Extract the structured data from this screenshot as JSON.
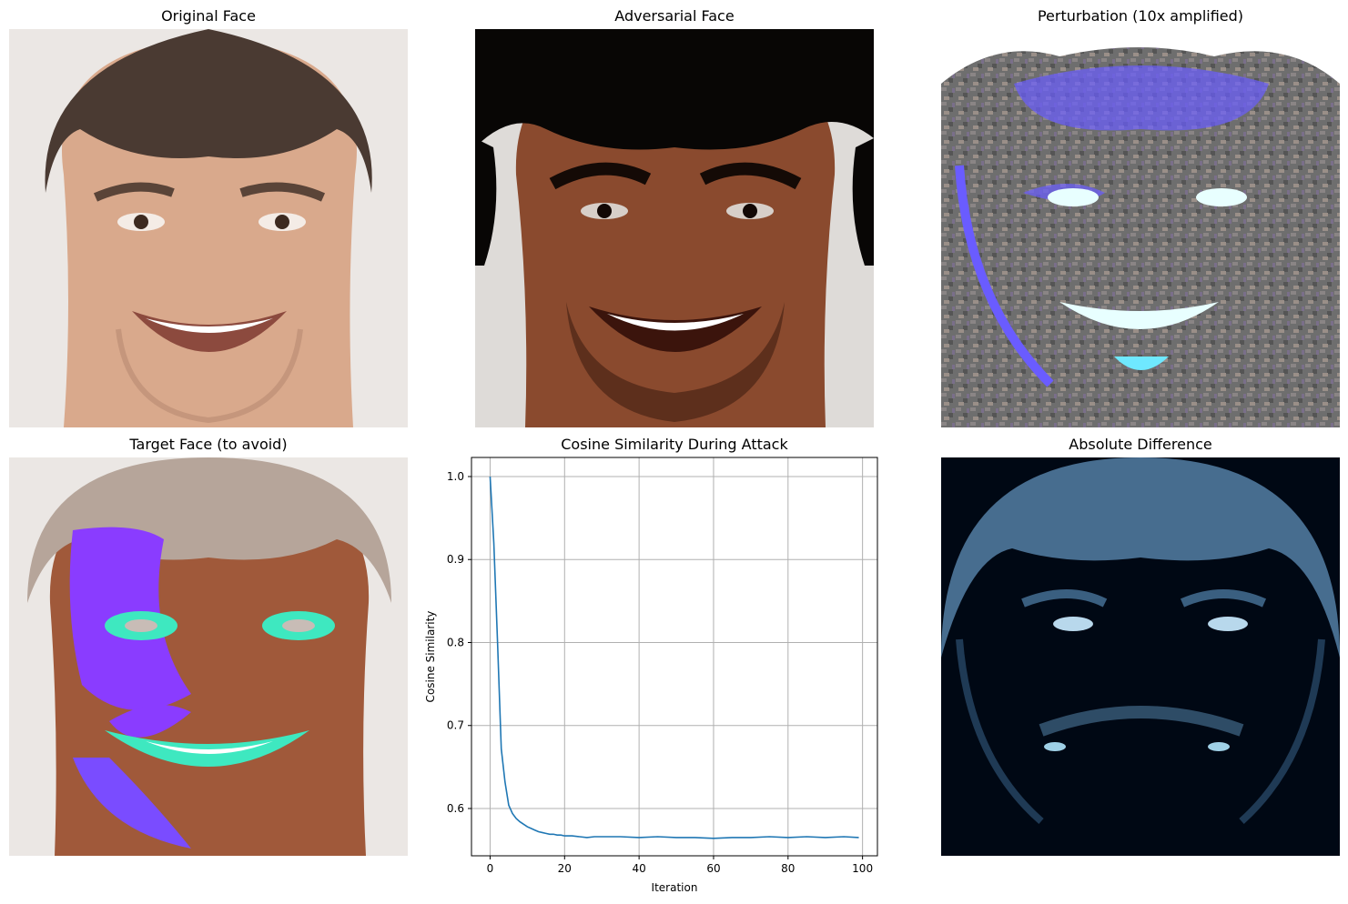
{
  "panels": {
    "original_title": "Original Face",
    "adversarial_title": "Adversarial Face",
    "perturbation_title": "Perturbation (10x amplified)",
    "target_title": "Target Face (to avoid)",
    "chart_title": "Cosine Similarity During Attack",
    "difference_title": "Absolute Difference"
  },
  "colors": {
    "line": "#1f77b4",
    "grid": "#b0b0b0",
    "skin_original": "#d9a98c",
    "skin_adversarial": "#8a4a2e",
    "perturbation_bg": "#6e6e6e",
    "perturbation_accent": "#6a5cff",
    "difference_bg": "#000814",
    "difference_accent": "#5f8fb8"
  },
  "chart_data": {
    "type": "line",
    "title": "Cosine Similarity During Attack",
    "xlabel": "Iteration",
    "ylabel": "Cosine Similarity",
    "xlim": [
      -5,
      104
    ],
    "ylim": [
      0.543,
      1.023
    ],
    "xticks": [
      0,
      20,
      40,
      60,
      80,
      100
    ],
    "yticks": [
      0.6,
      0.7,
      0.8,
      0.9,
      1.0
    ],
    "grid": true,
    "series": [
      {
        "x": [
          0,
          1,
          2,
          3,
          4,
          5,
          6,
          7,
          8,
          9,
          10,
          11,
          12,
          13,
          14,
          15,
          16,
          17,
          18,
          19,
          20,
          22,
          24,
          26,
          28,
          30,
          35,
          40,
          45,
          50,
          55,
          60,
          65,
          70,
          75,
          80,
          85,
          90,
          95,
          99
        ],
        "values": [
          1.0,
          0.92,
          0.8,
          0.672,
          0.632,
          0.604,
          0.594,
          0.588,
          0.584,
          0.581,
          0.578,
          0.576,
          0.574,
          0.572,
          0.571,
          0.57,
          0.569,
          0.569,
          0.568,
          0.568,
          0.567,
          0.567,
          0.566,
          0.565,
          0.566,
          0.566,
          0.566,
          0.565,
          0.566,
          0.565,
          0.565,
          0.564,
          0.565,
          0.565,
          0.566,
          0.565,
          0.566,
          0.565,
          0.566,
          0.565
        ]
      }
    ]
  }
}
